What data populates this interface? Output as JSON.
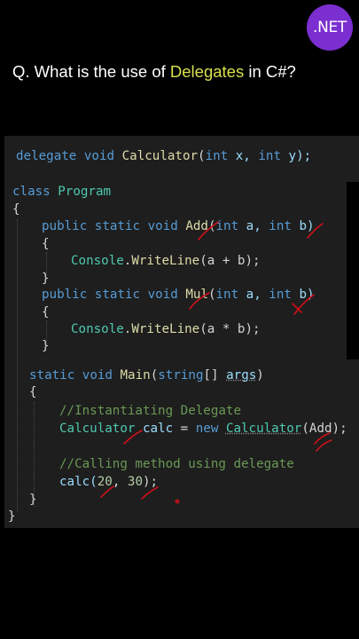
{
  "badge": {
    "label": ".NET"
  },
  "question": {
    "prefix": "Q. What is the use of ",
    "highlight": "Delegates",
    "suffix": " in C#?"
  },
  "code": {
    "l1": {
      "a": "delegate",
      "b": " ",
      "c": "void",
      "d": " ",
      "e": "Calculator",
      "f": "(",
      "g": "int",
      "h": " x, ",
      "i": "int",
      "j": " y);"
    },
    "l2": {
      "a": "class",
      "b": " ",
      "c": "Program"
    },
    "l3": {
      "a": "{"
    },
    "l4": {
      "a": "public",
      "b": " ",
      "c": "static",
      "d": " ",
      "e": "void",
      "f": " ",
      "g": "Add",
      "h": "(",
      "i": "int",
      "j": " a, ",
      "k": "int",
      "l": " b)"
    },
    "l5": {
      "a": "{"
    },
    "l6": {
      "a": "Console",
      "b": ".",
      "c": "WriteLine",
      "d": "(a + b);"
    },
    "l7": {
      "a": "}"
    },
    "l8": {
      "a": "public",
      "b": " ",
      "c": "static",
      "d": " ",
      "e": "void",
      "f": " ",
      "g": "Mul",
      "h": "(",
      "i": "int",
      "j": " a, ",
      "k": "int",
      "l": " b)"
    },
    "l9": {
      "a": "{"
    },
    "l10": {
      "a": "Console",
      "b": ".",
      "c": "WriteLine",
      "d": "(a * b);"
    },
    "l11": {
      "a": "}"
    },
    "l12": {
      "a": "static",
      "b": " ",
      "c": "void",
      "d": " ",
      "e": "Main",
      "f": "(",
      "g": "string",
      "h": "[] ",
      "i": "args",
      "j": ")"
    },
    "l13": {
      "a": "{"
    },
    "l14": {
      "a": "//Instantiating Delegate"
    },
    "l15": {
      "a": "Calculator",
      "b": " ",
      "c": "calc",
      "d": " = ",
      "e": "new",
      "f": " ",
      "g": "Calculator",
      "h": "(Add);"
    },
    "l16": {
      "a": "//Calling method using delegate"
    },
    "l17": {
      "a": "calc(",
      "b": "20",
      "c": ", ",
      "d": "30",
      "e": ");"
    },
    "l18": {
      "a": "}"
    },
    "l19": {
      "a": "}"
    }
  },
  "colors": {
    "background": "#000000",
    "panel": "#1e1e1e",
    "keyword": "#569cd6",
    "type": "#4ec9b0",
    "method": "#dcdcaa",
    "comment": "#6a9955",
    "number": "#b5cea8",
    "highlight": "#d8e04c",
    "annotation": "#d0101a",
    "badge": "#7b2fd0"
  }
}
